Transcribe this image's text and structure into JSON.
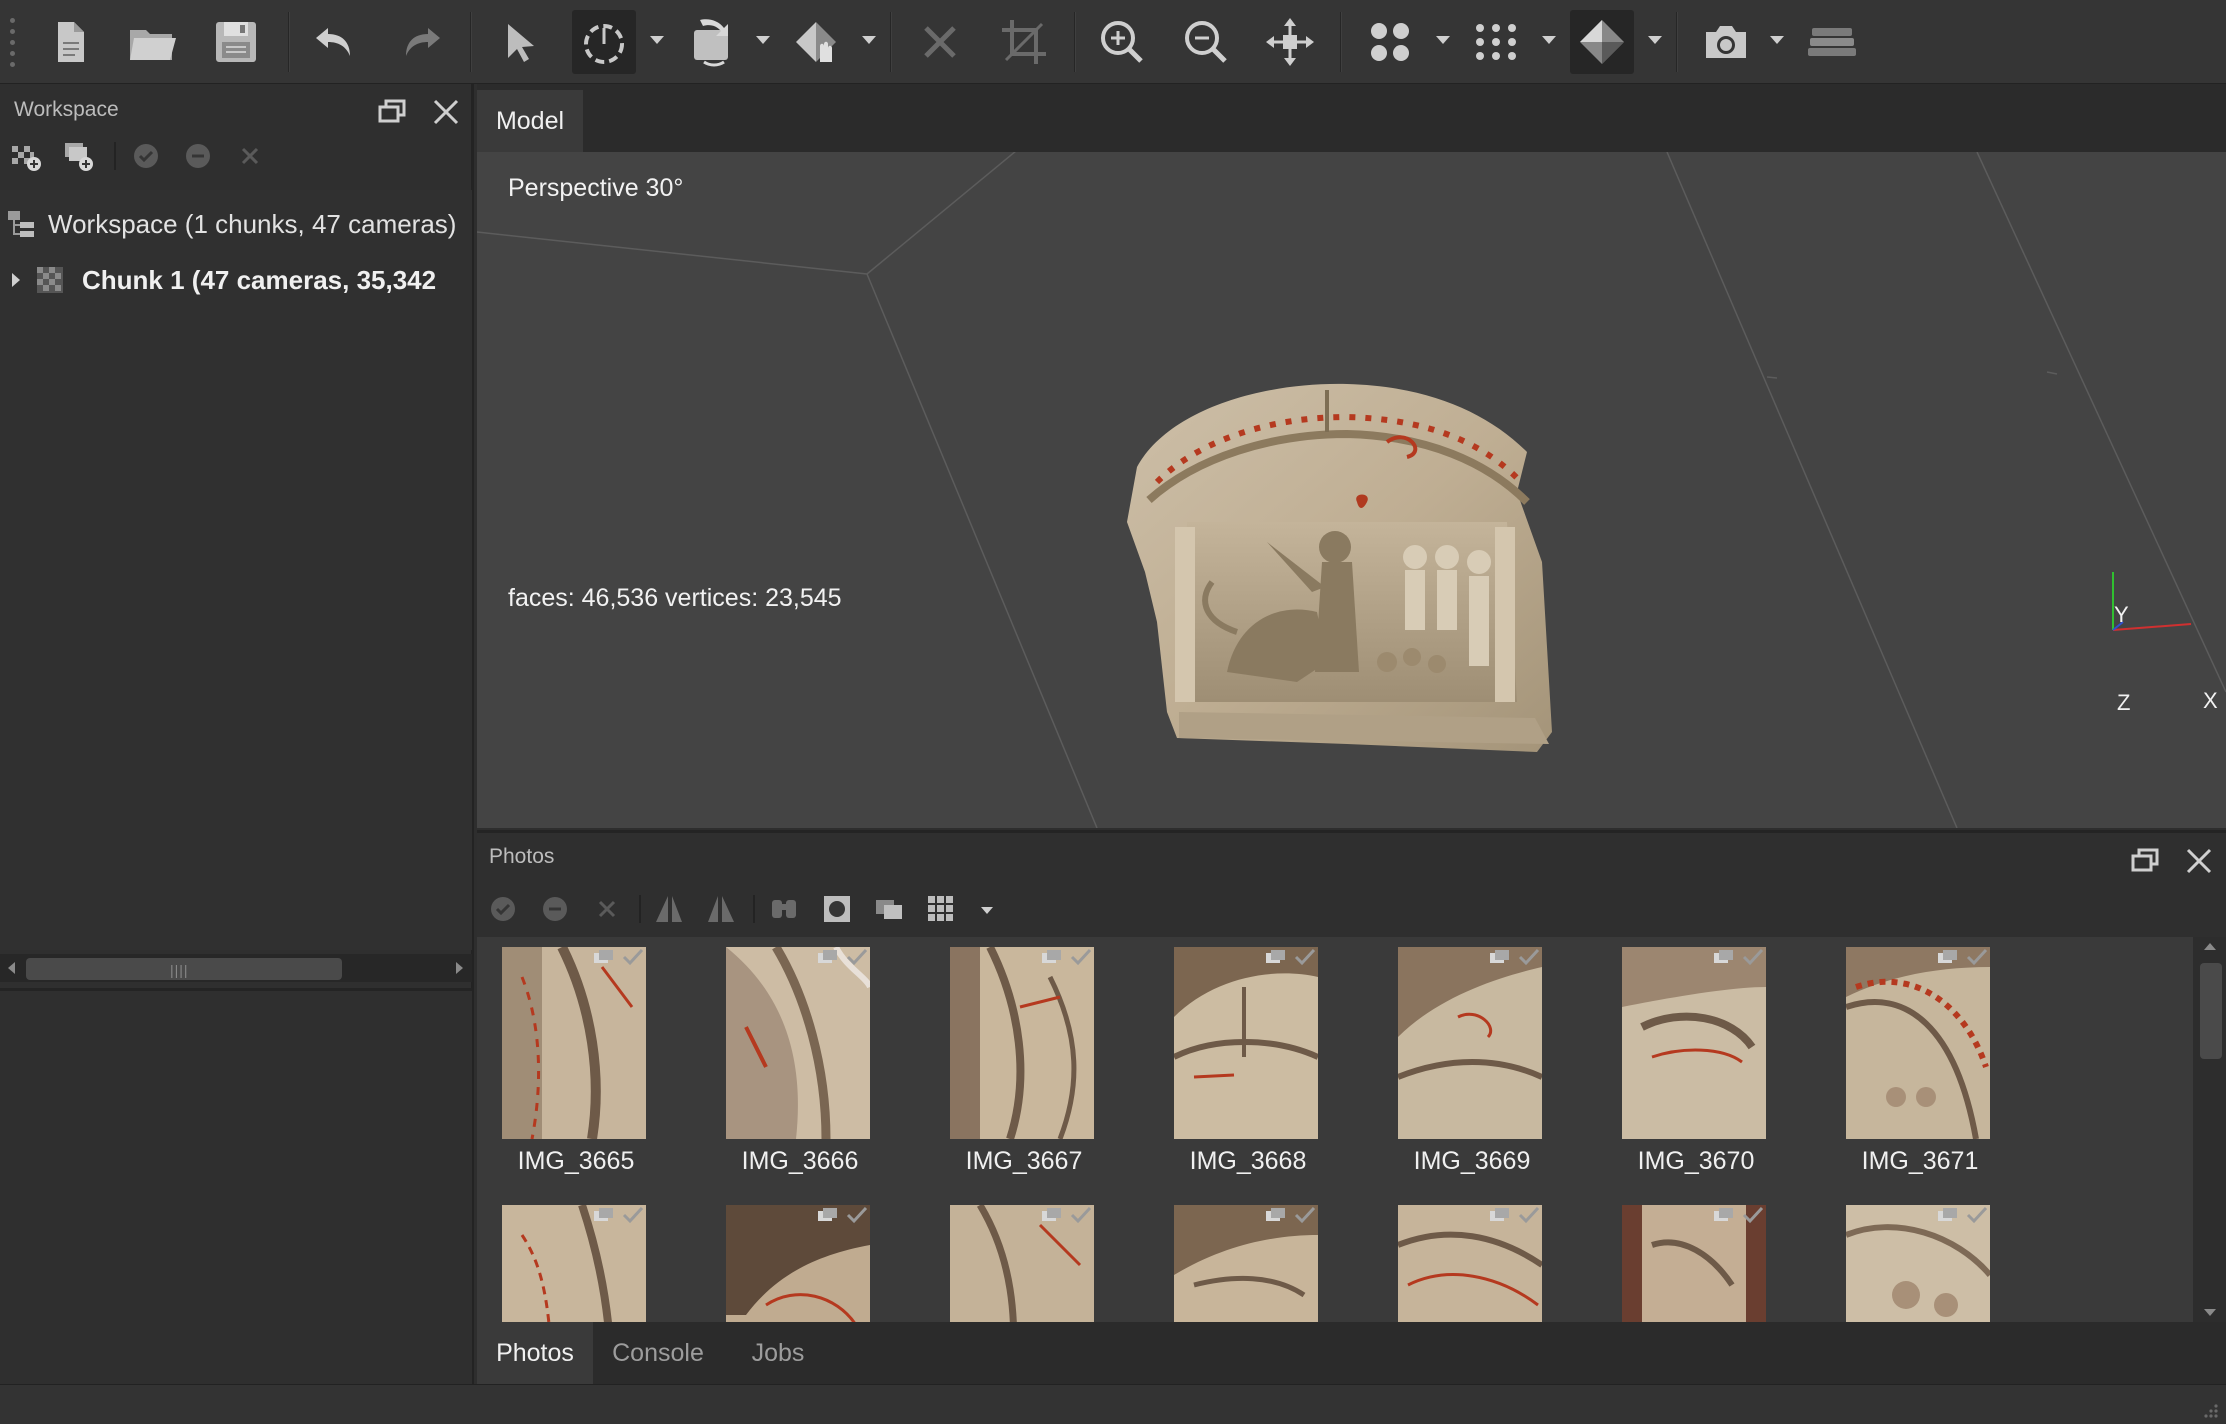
{
  "panels": {
    "workspace_title": "Workspace",
    "photos_title": "Photos"
  },
  "workspace": {
    "root_label": "Workspace (1 chunks, 47 cameras)",
    "chunk_label": "Chunk 1 (47 cameras, 35,342"
  },
  "model": {
    "tab_label": "Model",
    "projection": "Perspective 30°",
    "stats": "faces: 46,536 vertices: 23,545",
    "axes": {
      "y": "Y",
      "z": "Z",
      "x": "X"
    }
  },
  "photos": {
    "row1": [
      "IMG_3665",
      "IMG_3666",
      "IMG_3667",
      "IMG_3668",
      "IMG_3669",
      "IMG_3670",
      "IMG_3671"
    ]
  },
  "bottom_tabs": [
    "Photos",
    "Console",
    "Jobs"
  ],
  "colors": {
    "toolbar_bg": "#353535",
    "viewport_bg": "#444444",
    "panel_bg": "#2f2f2f",
    "axis_x": "#d03030",
    "axis_y": "#30c030",
    "axis_z": "#3050d0"
  }
}
